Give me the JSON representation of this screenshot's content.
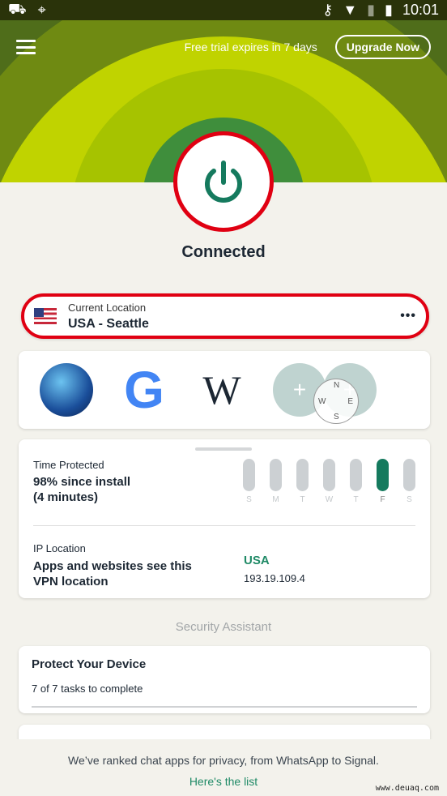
{
  "status_bar": {
    "time": "10:01"
  },
  "header": {
    "trial_text": "Free trial expires in 7 days",
    "upgrade_label": "Upgrade Now"
  },
  "connection": {
    "status": "Connected",
    "accent": "#157a5e"
  },
  "location": {
    "label": "Current Location",
    "value": "USA - Seattle",
    "more": "•••"
  },
  "shortcuts": [
    {
      "icon": "globe-icon"
    },
    {
      "icon": "google-icon",
      "glyph": "G"
    },
    {
      "icon": "wikipedia-icon",
      "glyph": "W"
    },
    {
      "icon": "add-icon",
      "glyph": "+"
    },
    {
      "icon": "add-icon",
      "glyph": "+"
    }
  ],
  "compass": {
    "n": "N",
    "s": "S",
    "e": "E",
    "w": "W"
  },
  "time_protected": {
    "label": "Time Protected",
    "value": "98% since install",
    "duration": "(4 minutes)",
    "days": [
      {
        "d": "S",
        "active": false
      },
      {
        "d": "M",
        "active": false
      },
      {
        "d": "T",
        "active": false
      },
      {
        "d": "W",
        "active": false
      },
      {
        "d": "T",
        "active": false
      },
      {
        "d": "F",
        "active": true
      },
      {
        "d": "S",
        "active": false
      }
    ]
  },
  "ip_location": {
    "label": "IP Location",
    "description": "Apps and websites see this VPN location",
    "country": "USA",
    "ip": "193.19.109.4"
  },
  "security_assistant": {
    "title": "Security Assistant",
    "card_title": "Protect Your Device",
    "card_subtitle": "7 of 7 tasks to complete"
  },
  "banner": {
    "text": "We’ve ranked chat apps for privacy, from WhatsApp to Signal.",
    "link": "Here's the list"
  },
  "watermark": "www.deuaq.com"
}
